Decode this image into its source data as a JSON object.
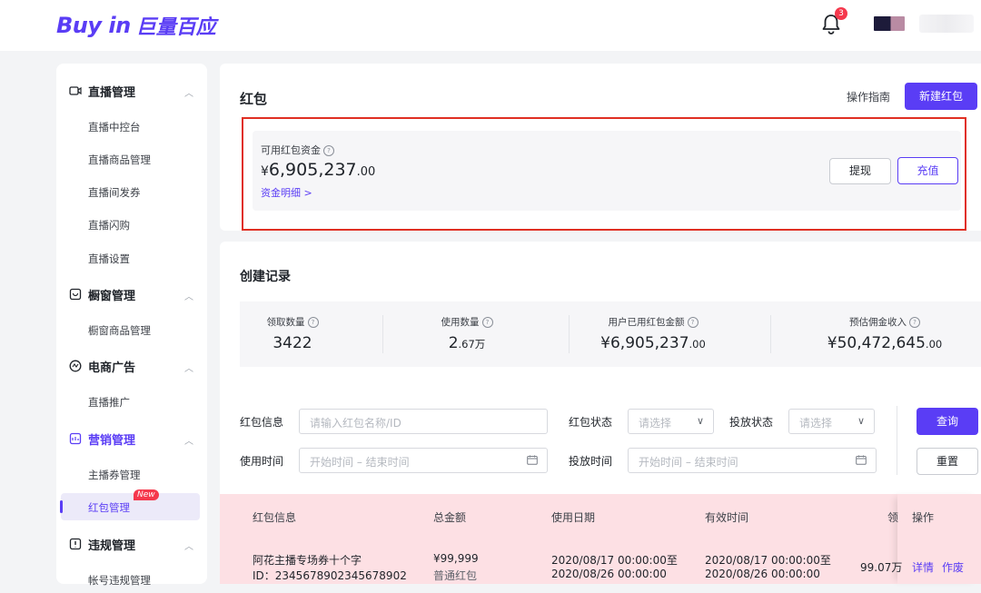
{
  "brand": {
    "latin": "Buy in",
    "cn": "巨量百应"
  },
  "header": {
    "notification_count": "3"
  },
  "sidebar": {
    "groups": [
      {
        "label": "直播管理",
        "icon": "live-icon",
        "items": [
          "直播中控台",
          "直播商品管理",
          "直播间发券",
          "直播闪购",
          "直播设置"
        ]
      },
      {
        "label": "橱窗管理",
        "icon": "showcase-icon",
        "items": [
          "橱窗商品管理"
        ]
      },
      {
        "label": "电商广告",
        "icon": "ad-icon",
        "items": [
          "直播推广"
        ]
      },
      {
        "label": "营销管理",
        "icon": "marketing-icon",
        "items": [
          "主播券管理",
          "红包管理"
        ]
      },
      {
        "label": "违规管理",
        "icon": "violation-icon",
        "items": [
          "帐号违规管理"
        ]
      }
    ],
    "active_item": "红包管理",
    "new_badge": "New"
  },
  "redpacket": {
    "title": "红包",
    "guide_link": "操作指南",
    "new_button": "新建红包",
    "fund_label": "可用红包资金",
    "fund_currency": "¥",
    "fund_amount_main": "6,905,237",
    "fund_amount_decimal": ".00",
    "fund_detail_link": "资金明细 >",
    "withdraw_button": "提现",
    "recharge_button": "充值"
  },
  "records": {
    "title": "创建记录",
    "stats": [
      {
        "label": "领取数量",
        "value_main": "3422",
        "value_suffix": ""
      },
      {
        "label": "使用数量",
        "value_main": "2",
        "value_suffix": ".67万"
      },
      {
        "label": "用户已用红包金额",
        "value_main": "¥6,905,237",
        "value_suffix": ".00"
      },
      {
        "label": "预估佣金收入",
        "value_main": "¥50,472,645",
        "value_suffix": ".00"
      }
    ]
  },
  "filters": {
    "info_label": "红包信息",
    "info_placeholder": "请输入红包名称/ID",
    "status_label": "红包状态",
    "status_placeholder": "请选择",
    "delivery_label": "投放状态",
    "delivery_placeholder": "请选择",
    "use_time_label": "使用时间",
    "delivery_time_label": "投放时间",
    "start_placeholder": "开始时间",
    "range_sep": "–",
    "end_placeholder": "结束时间",
    "query_button": "查询",
    "reset_button": "重置"
  },
  "table": {
    "columns": [
      "红包信息",
      "总金额",
      "使用日期",
      "有效时间",
      "领",
      "操作"
    ],
    "rows": [
      {
        "name": "阿花主播专场券十个字",
        "id": "ID：2345678902345678902",
        "amount": "¥99,999",
        "type": "普通红包",
        "use_date_start": "2020/08/17 00:00:00至",
        "use_date_end": "2020/08/26 00:00:00",
        "valid_start": "2020/08/17 00:00:00至",
        "valid_end": "2020/08/26 00:00:00",
        "claimed": "99.07万",
        "action_detail": "详情",
        "action_void": "作废"
      }
    ]
  }
}
